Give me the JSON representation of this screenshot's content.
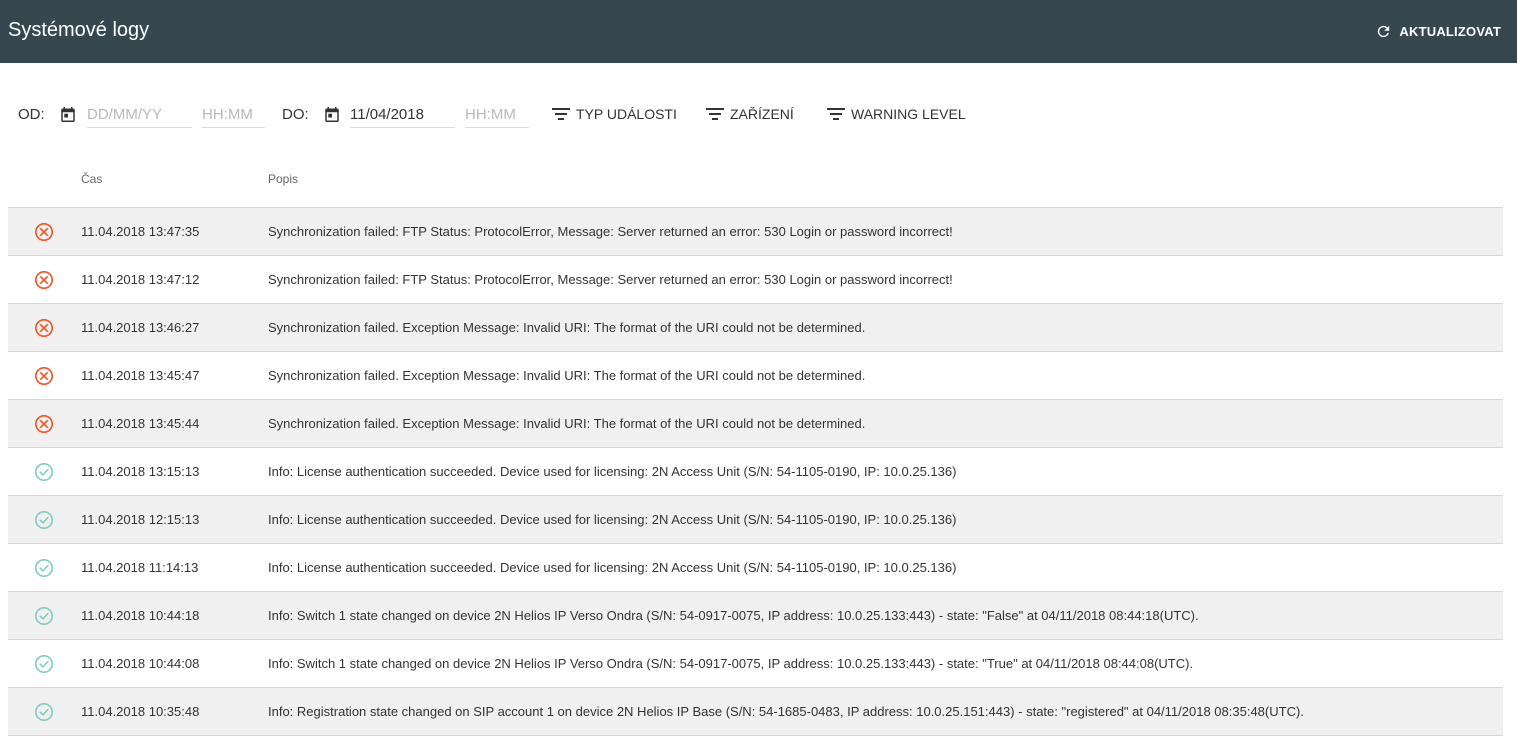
{
  "header": {
    "title": "Systémové logy",
    "refresh_label": "AKTUALIZOVAT"
  },
  "filters": {
    "from_label": "OD:",
    "from_date_placeholder": "DD/MM/YY",
    "from_time_placeholder": "HH:MM",
    "to_label": "DO:",
    "to_date_value": "11/04/2018",
    "to_time_placeholder": "HH:MM",
    "event_type_label": "TYP UDÁLOSTI",
    "device_label": "ZAŘÍZENÍ",
    "warning_level_label": "WARNING LEVEL"
  },
  "table": {
    "columns": [
      "Čas",
      "Popis"
    ],
    "rows": [
      {
        "status": "error",
        "time": "11.04.2018 13:47:35",
        "description": "Synchronization failed: FTP Status: ProtocolError, Message: Server returned an error: 530 Login or password incorrect!"
      },
      {
        "status": "error",
        "time": "11.04.2018 13:47:12",
        "description": "Synchronization failed: FTP Status: ProtocolError, Message: Server returned an error: 530 Login or password incorrect!"
      },
      {
        "status": "error",
        "time": "11.04.2018 13:46:27",
        "description": "Synchronization failed. Exception Message: Invalid URI: The format of the URI could not be determined."
      },
      {
        "status": "error",
        "time": "11.04.2018 13:45:47",
        "description": "Synchronization failed. Exception Message: Invalid URI: The format of the URI could not be determined."
      },
      {
        "status": "error",
        "time": "11.04.2018 13:45:44",
        "description": "Synchronization failed. Exception Message: Invalid URI: The format of the URI could not be determined."
      },
      {
        "status": "ok",
        "time": "11.04.2018 13:15:13",
        "description": "Info: License authentication succeeded. Device used for licensing: 2N Access Unit (S/N: 54-1105-0190, IP: 10.0.25.136)"
      },
      {
        "status": "ok",
        "time": "11.04.2018 12:15:13",
        "description": "Info: License authentication succeeded. Device used for licensing: 2N Access Unit (S/N: 54-1105-0190, IP: 10.0.25.136)"
      },
      {
        "status": "ok",
        "time": "11.04.2018 11:14:13",
        "description": "Info: License authentication succeeded. Device used for licensing: 2N Access Unit (S/N: 54-1105-0190, IP: 10.0.25.136)"
      },
      {
        "status": "ok",
        "time": "11.04.2018 10:44:18",
        "description": "Info: Switch 1 state changed on device 2N Helios IP Verso Ondra (S/N: 54-0917-0075, IP address: 10.0.25.133:443) - state: \"False\" at 04/11/2018 08:44:18(UTC)."
      },
      {
        "status": "ok",
        "time": "11.04.2018 10:44:08",
        "description": "Info: Switch 1 state changed on device 2N Helios IP Verso Ondra (S/N: 54-0917-0075, IP address: 10.0.25.133:443) - state: \"True\" at 04/11/2018 08:44:08(UTC)."
      },
      {
        "status": "ok",
        "time": "11.04.2018 10:35:48",
        "description": "Info: Registration state changed on SIP account 1 on device 2N Helios IP Base (S/N: 54-1685-0483, IP address: 10.0.25.151:443) - state: \"registered\" at 04/11/2018 08:35:48(UTC)."
      }
    ]
  },
  "colors": {
    "header_bg": "#37474f",
    "error": "#f4511e",
    "ok": "#80cbc4"
  }
}
